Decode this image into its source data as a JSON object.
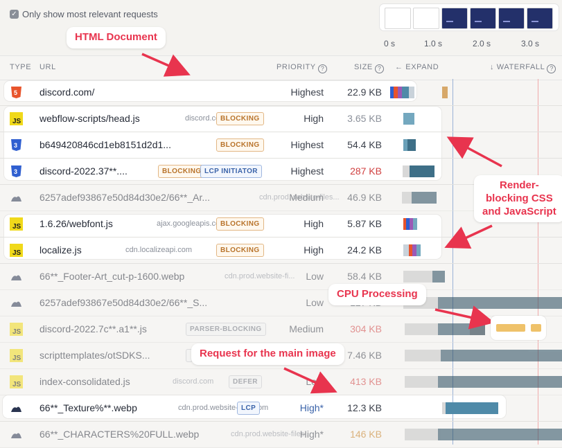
{
  "filter": {
    "label": "Only show most relevant requests",
    "checked": true
  },
  "timeline": {
    "labels": [
      "0 s",
      "1.0 s",
      "2.0 s",
      "3.0 s"
    ]
  },
  "columns": {
    "type": "TYPE",
    "url": "URL",
    "priority": "PRIORITY",
    "size": "SIZE",
    "expand": "← EXPAND",
    "waterfall": "↓ WATERFALL"
  },
  "rows": [
    {
      "type": "html",
      "url": "discord.com/",
      "host": "",
      "tags": [],
      "priority": "Highest",
      "size": "22.9 KB"
    },
    {
      "type": "js",
      "url": "webflow-scripts/head.js",
      "host": "discord.com",
      "tags": [
        "BLOCKING"
      ],
      "priority": "High",
      "size": "3.65 KB"
    },
    {
      "type": "css",
      "url": "b649420846cd1eb8151d2d1...",
      "host": "discord....",
      "tags": [
        "BLOCKING"
      ],
      "priority": "Highest",
      "size": "54.4 KB"
    },
    {
      "type": "css",
      "url": "discord-2022.37**....",
      "host": "cdn....",
      "tags": [
        "BLOCKING",
        "LCP INITIATOR"
      ],
      "priority": "Highest",
      "size": "287 KB"
    },
    {
      "type": "img",
      "url": "6257adef93867e50d84d30e2/66**_Ar...",
      "host": "cdn.prod.website-files...",
      "tags": [],
      "priority": "Medium",
      "size": "46.9 KB"
    },
    {
      "type": "js",
      "url": "1.6.26/webfont.js",
      "host": "ajax.googleapis.com",
      "tags": [
        "BLOCKING"
      ],
      "priority": "High",
      "size": "5.87 KB"
    },
    {
      "type": "js",
      "url": "localize.js",
      "host": "cdn.localizeapi.com",
      "tags": [
        "BLOCKING"
      ],
      "priority": "High",
      "size": "24.2 KB"
    },
    {
      "type": "img",
      "url": "66**_Footer-Art_cut-p-1600.webp",
      "host": "cdn.prod.website-fi...",
      "tags": [],
      "priority": "Low",
      "size": "58.4 KB"
    },
    {
      "type": "img",
      "url": "6257adef93867e50d84d30e2/66**_S...",
      "host": "",
      "tags": [],
      "priority": "Low",
      "size": "127 KB"
    },
    {
      "type": "js",
      "url": "discord-2022.7c**.a1**.js",
      "host": "cdn....",
      "tags": [
        "PARSER-BLOCKING"
      ],
      "priority": "Medium",
      "size": "304 KB"
    },
    {
      "type": "js",
      "url": "scripttemplates/otSDKS...",
      "host": "discor...",
      "tags": [
        ""
      ],
      "priority": "",
      "size": "7.46 KB"
    },
    {
      "type": "js",
      "url": "index-consolidated.js",
      "host": "discord.com",
      "tags": [
        "DEFER"
      ],
      "priority": "Low",
      "size": "413 KB"
    },
    {
      "type": "img",
      "url": "66**_Texture%**.webp",
      "host": "cdn.prod.website-files.com",
      "tags": [
        "LCP"
      ],
      "priority": "High*",
      "size": "12.3 KB"
    },
    {
      "type": "img",
      "url": "66**_CHARACTERS%20FULL.webp",
      "host": "cdn.prod.website-files...",
      "tags": [],
      "priority": "High*",
      "size": "146 KB"
    }
  ],
  "callouts": {
    "html_document": "HTML Document",
    "render_blocking_1": "Render-",
    "render_blocking_2": "blocking CSS",
    "render_blocking_3": "and JavaScript",
    "cpu": "CPU Processing",
    "main_image": "Request for the main image"
  },
  "colors": {
    "accent": "#e8344e",
    "js": "#f0d91a",
    "css": "#2f5fd0",
    "html": "#e8542c",
    "bar": "#4f8aa8",
    "cpu": "#efc26a"
  }
}
